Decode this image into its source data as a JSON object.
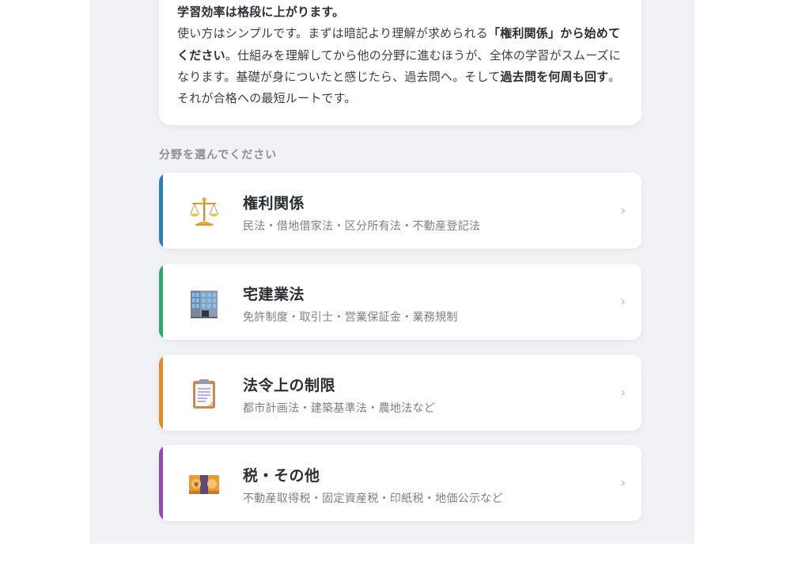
{
  "intro": {
    "line1_bold": "学習効率は格段に上がります。",
    "p2_a": "使い方はシンプルです。まずは暗記より理解が求められる",
    "p2_b_bold": "「権利関係」から始めてください",
    "p2_c": "。仕組みを理解してから他の分野に進むほうが、全体の学習がスムーズになります。基礎が身についたと感じたら、過去問へ。そして",
    "p2_d_bold": "過去問を何周も回す",
    "p2_e": "。それが合格への最短ルートです。"
  },
  "section_label": "分野を選んでください",
  "categories": [
    {
      "title": "権利関係",
      "desc": "民法・借地借家法・区分所有法・不動産登記法",
      "icon": "scales-icon",
      "accent": "#2f7fb5"
    },
    {
      "title": "宅建業法",
      "desc": "免許制度・取引士・営業保証金・業務規制",
      "icon": "office-building-icon",
      "accent": "#32a86a"
    },
    {
      "title": "法令上の制限",
      "desc": "都市計画法・建築基準法・農地法など",
      "icon": "clipboard-icon",
      "accent": "#e0892f"
    },
    {
      "title": "税・その他",
      "desc": "不動産取得税・固定資産税・印紙税・地価公示など",
      "icon": "yen-banknote-icon",
      "accent": "#8e4bb0"
    }
  ],
  "chevron": "›"
}
